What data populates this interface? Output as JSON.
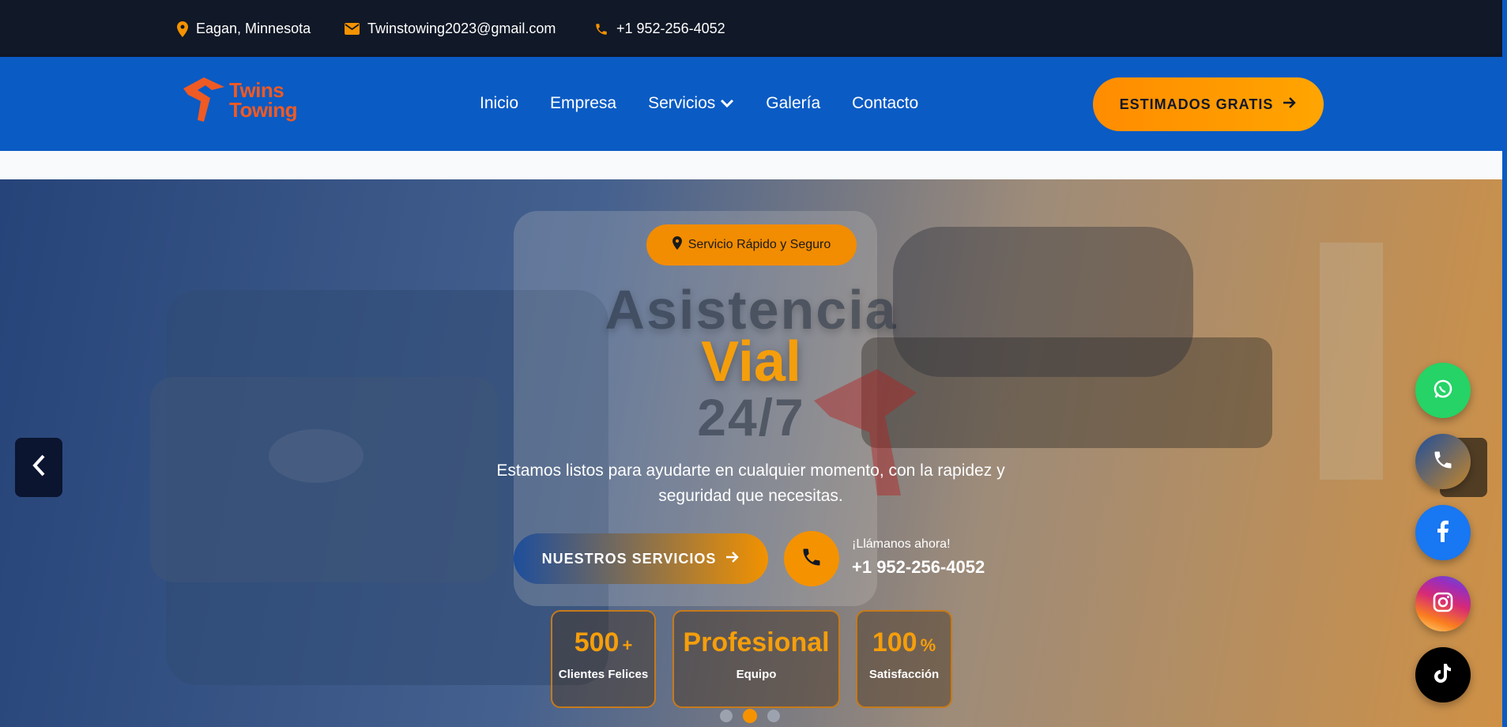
{
  "topbar": {
    "location": "Eagan, Minnesota",
    "email": "Twinstowing2023@gmail.com",
    "phone": "+1 952-256-4052"
  },
  "brand": {
    "line1": "Twins",
    "line2": "Towing",
    "color": "#f05a23"
  },
  "nav": {
    "items": [
      {
        "label": "Inicio"
      },
      {
        "label": "Empresa"
      },
      {
        "label": "Servicios"
      },
      {
        "label": "Galería"
      },
      {
        "label": "Contacto"
      }
    ],
    "cta": "ESTIMADOS GRATIS"
  },
  "hero": {
    "badge": "Servicio Rápido y Seguro",
    "title_line1": "Asistencia",
    "title_line2": "Vial",
    "title_line3": "24/7",
    "subtitle": "Estamos listos para ayudarte en cualquier momento, con la rapidez y seguridad que necesitas.",
    "services_button": "NUESTROS SERVICIOS",
    "call_label": "¡Llámanos ahora!",
    "call_number": "+1 952-256-4052",
    "stats": [
      {
        "value": "500",
        "unit": "+",
        "label": "Clientes Felices"
      },
      {
        "value": "Profesional",
        "unit": "",
        "label": "Equipo"
      },
      {
        "value": "100",
        "unit": "%",
        "label": "Satisfacción"
      }
    ],
    "slides_count": 3,
    "active_slide": 2
  },
  "colors": {
    "topbar_bg": "#111827",
    "nav_bg": "#0a5bc4",
    "accent": "#f59200",
    "whatsapp": "#25d366",
    "facebook": "#1877f2",
    "tiktok": "#000000"
  },
  "socials": [
    {
      "icon": "whatsapp-icon"
    },
    {
      "icon": "phone-icon"
    },
    {
      "icon": "facebook-icon"
    },
    {
      "icon": "instagram-icon"
    },
    {
      "icon": "tiktok-icon"
    }
  ]
}
